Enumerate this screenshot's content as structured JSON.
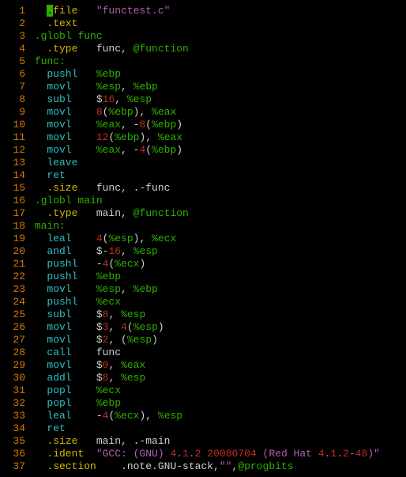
{
  "tokens": [
    [
      [
        "num",
        "  1"
      ],
      [
        "pl",
        "   "
      ],
      [
        "cursor",
        "."
      ],
      [
        "dir",
        "file   "
      ],
      [
        "str",
        "\"functest.c\""
      ]
    ],
    [
      [
        "num",
        "  2"
      ],
      [
        "pl",
        "   "
      ],
      [
        "dir",
        ".text"
      ]
    ],
    [
      [
        "num",
        "  3"
      ],
      [
        "pl",
        " "
      ],
      [
        "reg",
        ".globl func"
      ]
    ],
    [
      [
        "num",
        "  4"
      ],
      [
        "pl",
        "   "
      ],
      [
        "dir",
        ".type   "
      ],
      [
        "pl",
        "func, "
      ],
      [
        "reg",
        "@function"
      ]
    ],
    [
      [
        "num",
        "  5"
      ],
      [
        "pl",
        " "
      ],
      [
        "reg",
        "func:"
      ]
    ],
    [
      [
        "num",
        "  6"
      ],
      [
        "pl",
        "   "
      ],
      [
        "op",
        "pushl   "
      ],
      [
        "reg",
        "%ebp"
      ]
    ],
    [
      [
        "num",
        "  7"
      ],
      [
        "pl",
        "   "
      ],
      [
        "op",
        "movl    "
      ],
      [
        "reg",
        "%esp"
      ],
      [
        "pl",
        ", "
      ],
      [
        "reg",
        "%ebp"
      ]
    ],
    [
      [
        "num",
        "  8"
      ],
      [
        "pl",
        "   "
      ],
      [
        "op",
        "subl    "
      ],
      [
        "pl",
        "$"
      ],
      [
        "red",
        "16"
      ],
      [
        "pl",
        ", "
      ],
      [
        "reg",
        "%esp"
      ]
    ],
    [
      [
        "num",
        "  9"
      ],
      [
        "pl",
        "   "
      ],
      [
        "op",
        "movl    "
      ],
      [
        "red",
        "8"
      ],
      [
        "pl",
        "("
      ],
      [
        "reg",
        "%ebp"
      ],
      [
        "pl",
        "), "
      ],
      [
        "reg",
        "%eax"
      ]
    ],
    [
      [
        "num",
        " 10"
      ],
      [
        "pl",
        "   "
      ],
      [
        "op",
        "movl    "
      ],
      [
        "reg",
        "%eax"
      ],
      [
        "pl",
        ", -"
      ],
      [
        "red",
        "8"
      ],
      [
        "pl",
        "("
      ],
      [
        "reg",
        "%ebp"
      ],
      [
        "pl",
        ")"
      ]
    ],
    [
      [
        "num",
        " 11"
      ],
      [
        "pl",
        "   "
      ],
      [
        "op",
        "movl    "
      ],
      [
        "red",
        "12"
      ],
      [
        "pl",
        "("
      ],
      [
        "reg",
        "%ebp"
      ],
      [
        "pl",
        "), "
      ],
      [
        "reg",
        "%eax"
      ]
    ],
    [
      [
        "num",
        " 12"
      ],
      [
        "pl",
        "   "
      ],
      [
        "op",
        "movl    "
      ],
      [
        "reg",
        "%eax"
      ],
      [
        "pl",
        ", -"
      ],
      [
        "red",
        "4"
      ],
      [
        "pl",
        "("
      ],
      [
        "reg",
        "%ebp"
      ],
      [
        "pl",
        ")"
      ]
    ],
    [
      [
        "num",
        " 13"
      ],
      [
        "pl",
        "   "
      ],
      [
        "op",
        "leave"
      ]
    ],
    [
      [
        "num",
        " 14"
      ],
      [
        "pl",
        "   "
      ],
      [
        "op",
        "ret"
      ]
    ],
    [
      [
        "num",
        " 15"
      ],
      [
        "pl",
        "   "
      ],
      [
        "dir",
        ".size   "
      ],
      [
        "pl",
        "func, .-func"
      ]
    ],
    [
      [
        "num",
        " 16"
      ],
      [
        "pl",
        " "
      ],
      [
        "reg",
        ".globl main"
      ]
    ],
    [
      [
        "num",
        " 17"
      ],
      [
        "pl",
        "   "
      ],
      [
        "dir",
        ".type   "
      ],
      [
        "pl",
        "main, "
      ],
      [
        "reg",
        "@function"
      ]
    ],
    [
      [
        "num",
        " 18"
      ],
      [
        "pl",
        " "
      ],
      [
        "reg",
        "main:"
      ]
    ],
    [
      [
        "num",
        " 19"
      ],
      [
        "pl",
        "   "
      ],
      [
        "op",
        "leal    "
      ],
      [
        "red",
        "4"
      ],
      [
        "pl",
        "("
      ],
      [
        "reg",
        "%esp"
      ],
      [
        "pl",
        "), "
      ],
      [
        "reg",
        "%ecx"
      ]
    ],
    [
      [
        "num",
        " 20"
      ],
      [
        "pl",
        "   "
      ],
      [
        "op",
        "andl    "
      ],
      [
        "pl",
        "$-"
      ],
      [
        "red",
        "16"
      ],
      [
        "pl",
        ", "
      ],
      [
        "reg",
        "%esp"
      ]
    ],
    [
      [
        "num",
        " 21"
      ],
      [
        "pl",
        "   "
      ],
      [
        "op",
        "pushl   "
      ],
      [
        "pl",
        "-"
      ],
      [
        "red",
        "4"
      ],
      [
        "pl",
        "("
      ],
      [
        "reg",
        "%ecx"
      ],
      [
        "pl",
        ")"
      ]
    ],
    [
      [
        "num",
        " 22"
      ],
      [
        "pl",
        "   "
      ],
      [
        "op",
        "pushl   "
      ],
      [
        "reg",
        "%ebp"
      ]
    ],
    [
      [
        "num",
        " 23"
      ],
      [
        "pl",
        "   "
      ],
      [
        "op",
        "movl    "
      ],
      [
        "reg",
        "%esp"
      ],
      [
        "pl",
        ", "
      ],
      [
        "reg",
        "%ebp"
      ]
    ],
    [
      [
        "num",
        " 24"
      ],
      [
        "pl",
        "   "
      ],
      [
        "op",
        "pushl   "
      ],
      [
        "reg",
        "%ecx"
      ]
    ],
    [
      [
        "num",
        " 25"
      ],
      [
        "pl",
        "   "
      ],
      [
        "op",
        "subl    "
      ],
      [
        "pl",
        "$"
      ],
      [
        "red",
        "8"
      ],
      [
        "pl",
        ", "
      ],
      [
        "reg",
        "%esp"
      ]
    ],
    [
      [
        "num",
        " 26"
      ],
      [
        "pl",
        "   "
      ],
      [
        "op",
        "movl    "
      ],
      [
        "pl",
        "$"
      ],
      [
        "red",
        "3"
      ],
      [
        "pl",
        ", "
      ],
      [
        "red",
        "4"
      ],
      [
        "pl",
        "("
      ],
      [
        "reg",
        "%esp"
      ],
      [
        "pl",
        ")"
      ]
    ],
    [
      [
        "num",
        " 27"
      ],
      [
        "pl",
        "   "
      ],
      [
        "op",
        "movl    "
      ],
      [
        "pl",
        "$"
      ],
      [
        "red",
        "2"
      ],
      [
        "pl",
        ", ("
      ],
      [
        "reg",
        "%esp"
      ],
      [
        "pl",
        ")"
      ]
    ],
    [
      [
        "num",
        " 28"
      ],
      [
        "pl",
        "   "
      ],
      [
        "op",
        "call    "
      ],
      [
        "pl",
        "func"
      ]
    ],
    [
      [
        "num",
        " 29"
      ],
      [
        "pl",
        "   "
      ],
      [
        "op",
        "movl    "
      ],
      [
        "pl",
        "$"
      ],
      [
        "red",
        "0"
      ],
      [
        "pl",
        ", "
      ],
      [
        "reg",
        "%eax"
      ]
    ],
    [
      [
        "num",
        " 30"
      ],
      [
        "pl",
        "   "
      ],
      [
        "op",
        "addl    "
      ],
      [
        "pl",
        "$"
      ],
      [
        "red",
        "8"
      ],
      [
        "pl",
        ", "
      ],
      [
        "reg",
        "%esp"
      ]
    ],
    [
      [
        "num",
        " 31"
      ],
      [
        "pl",
        "   "
      ],
      [
        "op",
        "popl    "
      ],
      [
        "reg",
        "%ecx"
      ]
    ],
    [
      [
        "num",
        " 32"
      ],
      [
        "pl",
        "   "
      ],
      [
        "op",
        "popl    "
      ],
      [
        "reg",
        "%ebp"
      ]
    ],
    [
      [
        "num",
        " 33"
      ],
      [
        "pl",
        "   "
      ],
      [
        "op",
        "leal    "
      ],
      [
        "pl",
        "-"
      ],
      [
        "red",
        "4"
      ],
      [
        "pl",
        "("
      ],
      [
        "reg",
        "%ecx"
      ],
      [
        "pl",
        "), "
      ],
      [
        "reg",
        "%esp"
      ]
    ],
    [
      [
        "num",
        " 34"
      ],
      [
        "pl",
        "   "
      ],
      [
        "op",
        "ret"
      ]
    ],
    [
      [
        "num",
        " 35"
      ],
      [
        "pl",
        "   "
      ],
      [
        "dir",
        ".size   "
      ],
      [
        "pl",
        "main, .-main"
      ]
    ],
    [
      [
        "num",
        " 36"
      ],
      [
        "pl",
        "   "
      ],
      [
        "dir",
        ".ident  "
      ],
      [
        "str",
        "\"GCC: (GNU) "
      ],
      [
        "red",
        "4"
      ],
      [
        "str",
        "."
      ],
      [
        "red",
        "1"
      ],
      [
        "str",
        "."
      ],
      [
        "red",
        "2"
      ],
      [
        "str",
        " "
      ],
      [
        "red",
        "20080704"
      ],
      [
        "str",
        " (Red Hat "
      ],
      [
        "red",
        "4"
      ],
      [
        "str",
        "."
      ],
      [
        "red",
        "1"
      ],
      [
        "str",
        "."
      ],
      [
        "red",
        "2"
      ],
      [
        "str",
        "-"
      ],
      [
        "red",
        "48"
      ],
      [
        "str",
        ")\""
      ]
    ],
    [
      [
        "num",
        " 37"
      ],
      [
        "pl",
        "   "
      ],
      [
        "dir",
        ".section    "
      ],
      [
        "pl",
        ".note.GNU-stack,"
      ],
      [
        "str",
        "\"\""
      ],
      [
        "pl",
        ","
      ],
      [
        "reg",
        "@progbits"
      ]
    ]
  ]
}
